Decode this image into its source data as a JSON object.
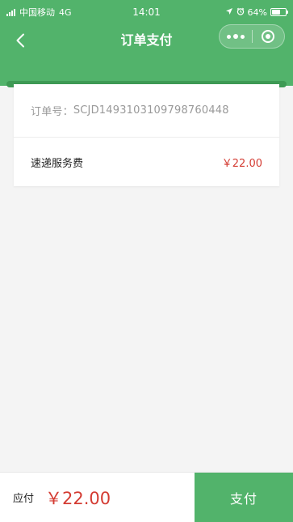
{
  "status_bar": {
    "carrier": "中国移动",
    "network": "4G",
    "time": "14:01",
    "battery": "64%",
    "battery_level": 0.64,
    "icons": [
      "signal-icon",
      "location-arrow-icon",
      "alarm-icon",
      "battery-icon"
    ]
  },
  "nav": {
    "title": "订单支付",
    "back_icon": "chevron-left-icon",
    "more_icon": "more-dots-icon",
    "close_icon": "target-circle-icon"
  },
  "order": {
    "order_number_label": "订单号：",
    "order_number": "SCJD1493103109798760448",
    "fee_label": "速递服务费",
    "fee_amount": "￥22.00"
  },
  "bottom_bar": {
    "payable_label": "应付",
    "payable_amount": "￥22.00",
    "pay_button_label": "支付"
  },
  "colors": {
    "brand_green": "#52b36b",
    "price_red": "#d43c33",
    "background": "#f4f4f4"
  }
}
